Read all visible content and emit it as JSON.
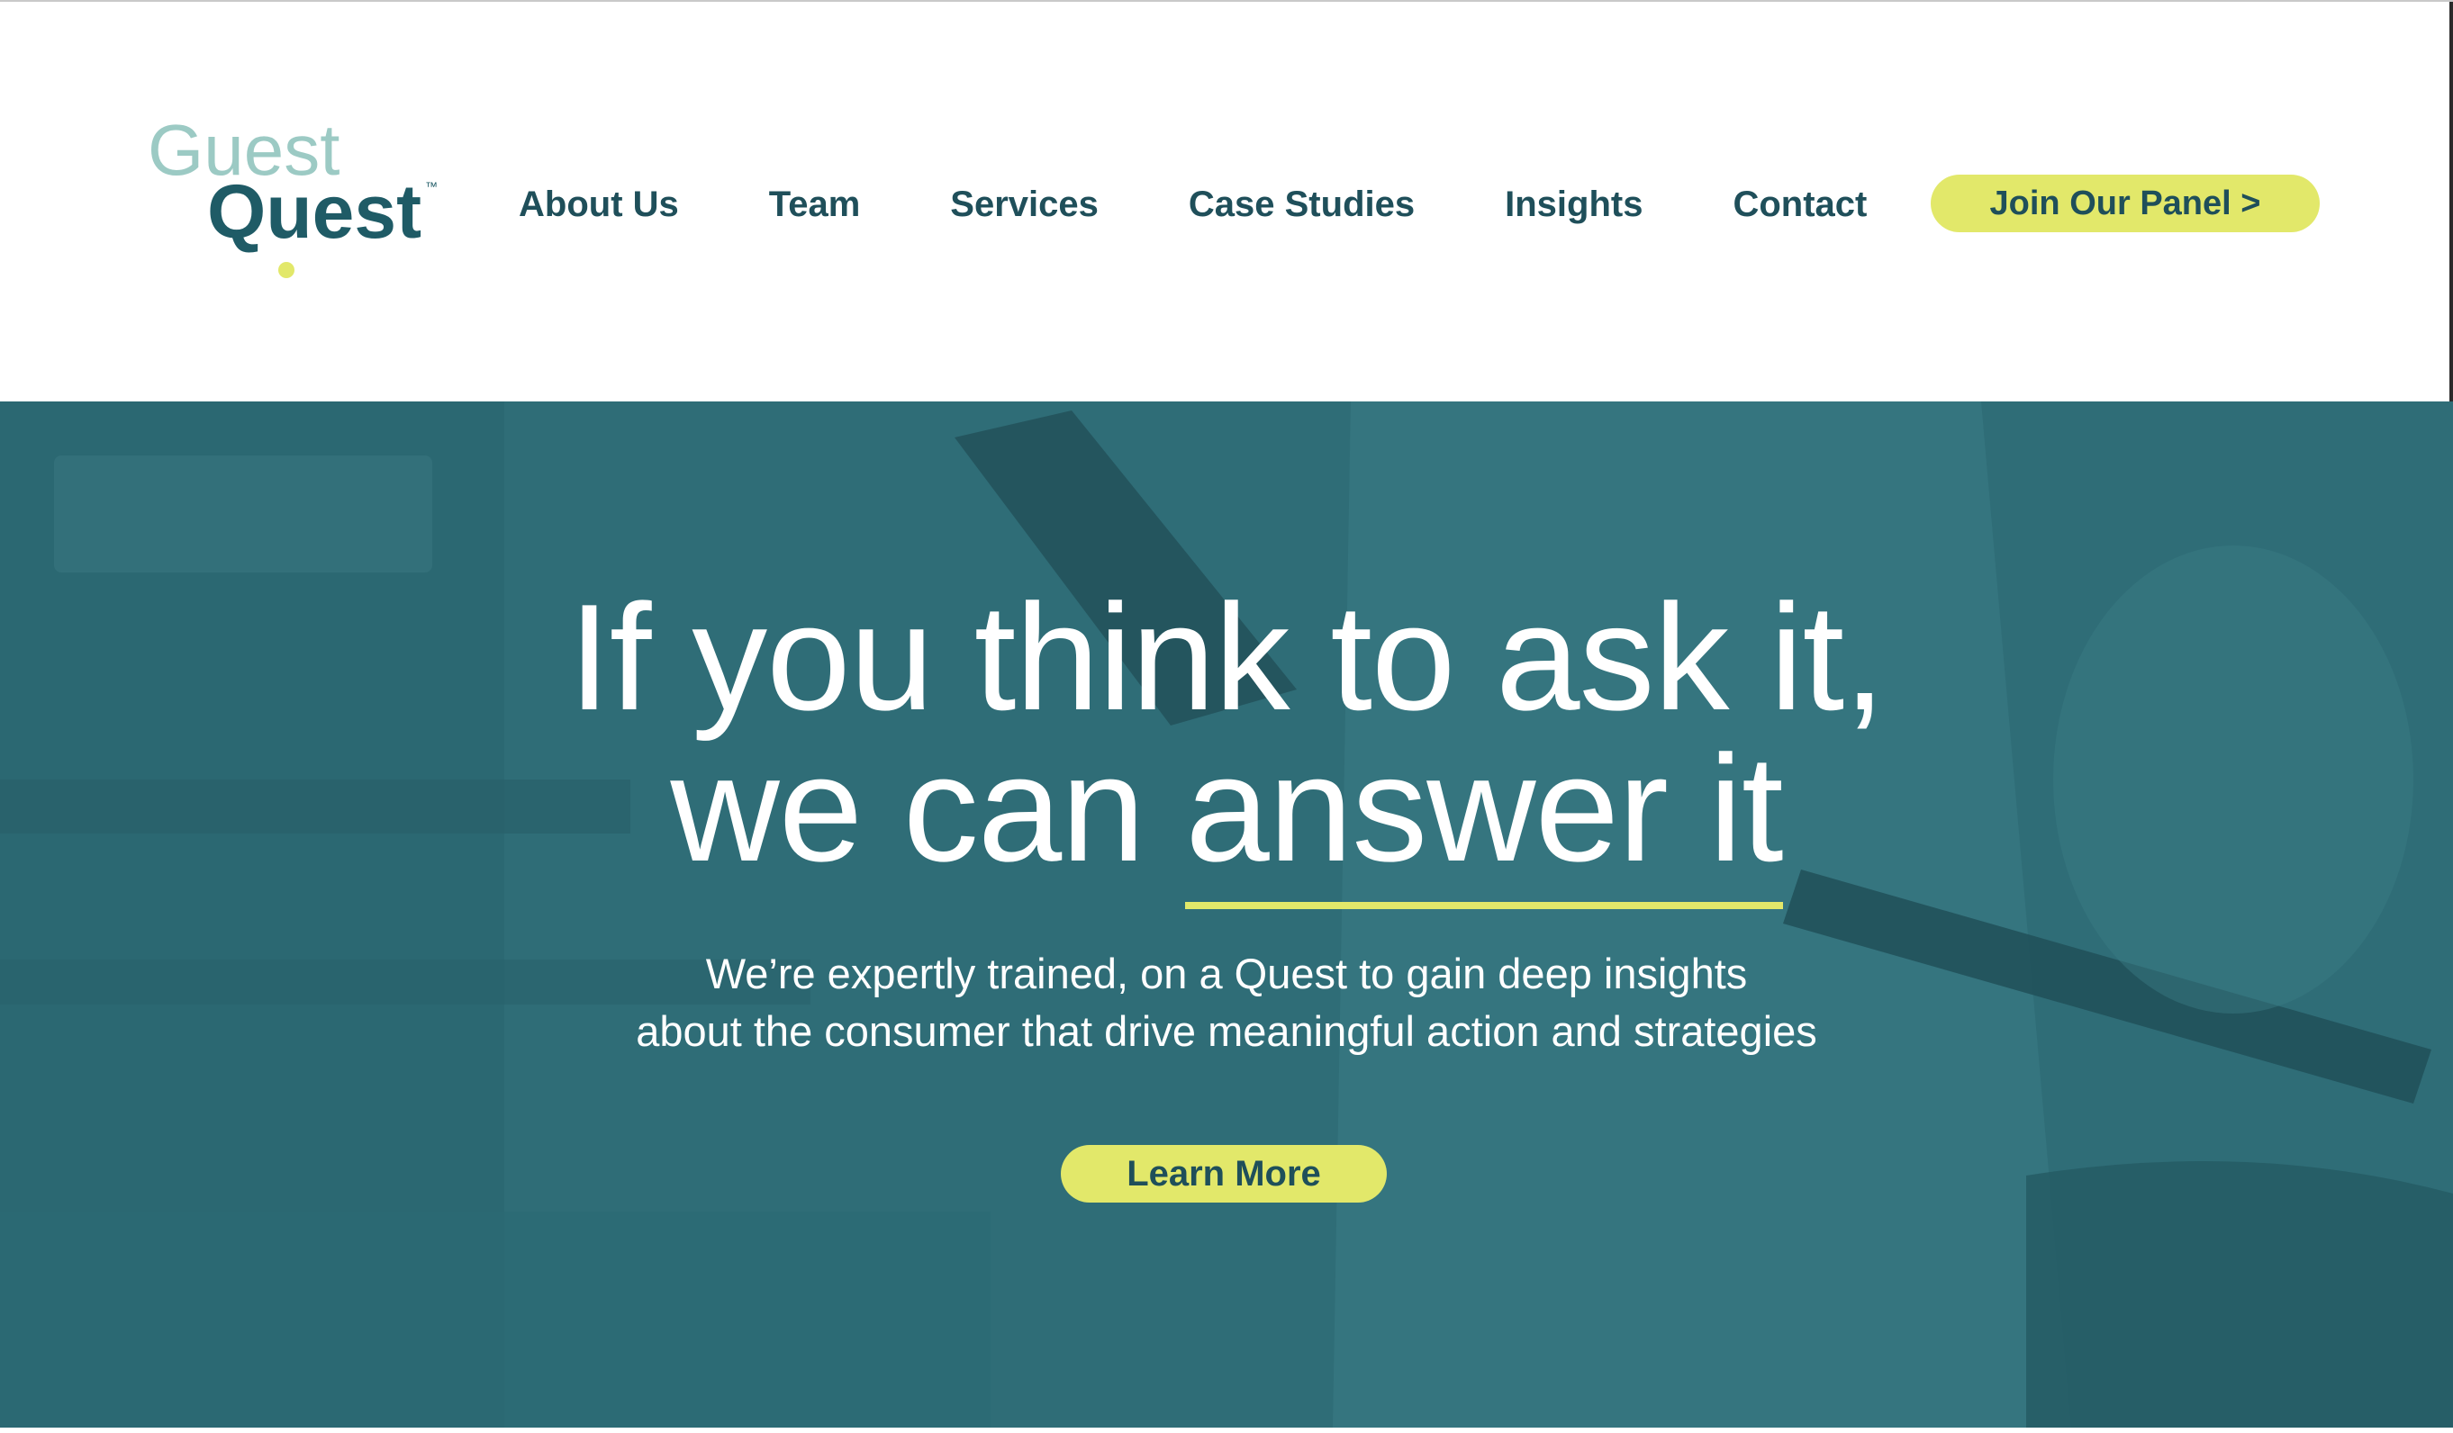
{
  "brand": {
    "logo_top_word": "Guest",
    "logo_bottom_word": "Quest",
    "trademark": "™",
    "colors": {
      "teal_dark": "#1f4f5a",
      "teal_light": "#9ccac4",
      "accent_yellow": "#e2e86a",
      "hero_bg": "#2f6d77"
    }
  },
  "nav": {
    "items": [
      {
        "label": "About Us"
      },
      {
        "label": "Team"
      },
      {
        "label": "Services"
      },
      {
        "label": "Case Studies"
      },
      {
        "label": "Insights"
      },
      {
        "label": "Contact"
      }
    ],
    "cta_label": "Join Our Panel >"
  },
  "hero": {
    "title_line1": "If you think to ask it,",
    "title_line2_prefix": "we can ",
    "title_line2_emphasis": "answer it",
    "subtitle_line1": "We’re expertly trained, on a Quest to gain deep insights",
    "subtitle_line2": "about the consumer that drive meaningful action and strategies",
    "button_label": "Learn More"
  }
}
